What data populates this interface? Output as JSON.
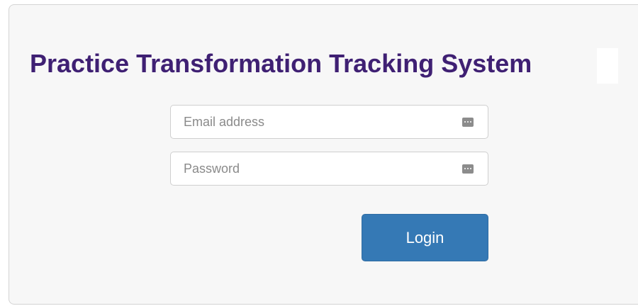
{
  "page": {
    "title": "Practice Transformation Tracking System"
  },
  "form": {
    "email_placeholder": "Email address",
    "email_value": "",
    "password_placeholder": "Password",
    "password_value": "",
    "login_label": "Login"
  },
  "icons": {
    "email_field_icon": "password-manager-icon",
    "password_field_icon": "password-manager-icon"
  },
  "colors": {
    "title": "#3f2073",
    "button": "#3579b5",
    "panel_background": "#f7f7f7"
  }
}
